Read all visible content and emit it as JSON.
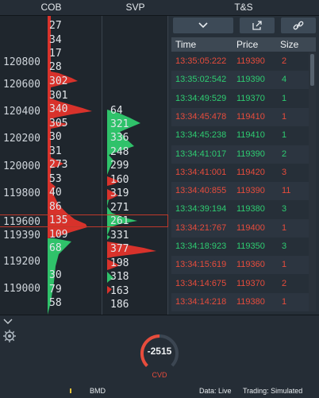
{
  "headers": {
    "cob": "COB",
    "svp": "SVP",
    "ts": "T&S"
  },
  "ladder_prices": [
    "120800",
    "120600",
    "120400",
    "120200",
    "120000",
    "119800",
    "119600",
    "119390",
    "119200",
    "119000"
  ],
  "cob_levels": [
    "27",
    "34",
    "17",
    "28",
    "302",
    "301",
    "340",
    "305",
    "30",
    "31",
    "273",
    "53",
    "40",
    "86",
    "135",
    "109",
    "68",
    "30",
    "79",
    "58"
  ],
  "svp_levels": [
    "64",
    "321",
    "336",
    "248",
    "299",
    "160",
    "319",
    "271",
    "261",
    "331",
    "377",
    "198",
    "318",
    "163",
    "186"
  ],
  "ts": {
    "columns": {
      "time": "Time",
      "price": "Price",
      "size": "Size"
    },
    "rows": [
      {
        "time": "13:35:05:222",
        "price": "119390",
        "size": "2",
        "side": "sell"
      },
      {
        "time": "13:35:02:542",
        "price": "119390",
        "size": "4",
        "side": "buy"
      },
      {
        "time": "13:34:49:529",
        "price": "119370",
        "size": "1",
        "side": "buy"
      },
      {
        "time": "13:34:45:478",
        "price": "119410",
        "size": "1",
        "side": "sell"
      },
      {
        "time": "13:34:45:238",
        "price": "119410",
        "size": "1",
        "side": "buy"
      },
      {
        "time": "13:34:41:017",
        "price": "119390",
        "size": "2",
        "side": "buy"
      },
      {
        "time": "13:34:41:001",
        "price": "119420",
        "size": "3",
        "side": "sell"
      },
      {
        "time": "13:34:40:855",
        "price": "119390",
        "size": "11",
        "side": "sell"
      },
      {
        "time": "13:34:39:194",
        "price": "119380",
        "size": "3",
        "side": "buy"
      },
      {
        "time": "13:34:21:767",
        "price": "119400",
        "size": "1",
        "side": "sell"
      },
      {
        "time": "13:34:18:923",
        "price": "119350",
        "size": "3",
        "side": "buy"
      },
      {
        "time": "13:34:15:619",
        "price": "119360",
        "size": "1",
        "side": "sell"
      },
      {
        "time": "13:34:14:675",
        "price": "119370",
        "size": "2",
        "side": "sell"
      },
      {
        "time": "13:34:14:218",
        "price": "119380",
        "size": "1",
        "side": "sell"
      }
    ]
  },
  "cvd": {
    "value": "-2515",
    "label": "CVD"
  },
  "status": {
    "symbol": "BMD",
    "data": "Data: Live",
    "trading": "Trading: Simulated"
  },
  "colors": {
    "buy": "#2ecc71",
    "sell": "#e74c3c",
    "cur_price": "#c0392b"
  },
  "icons": [
    "chevron-down-icon",
    "export-icon",
    "link-icon",
    "chevron-down-icon",
    "gear-icon"
  ]
}
